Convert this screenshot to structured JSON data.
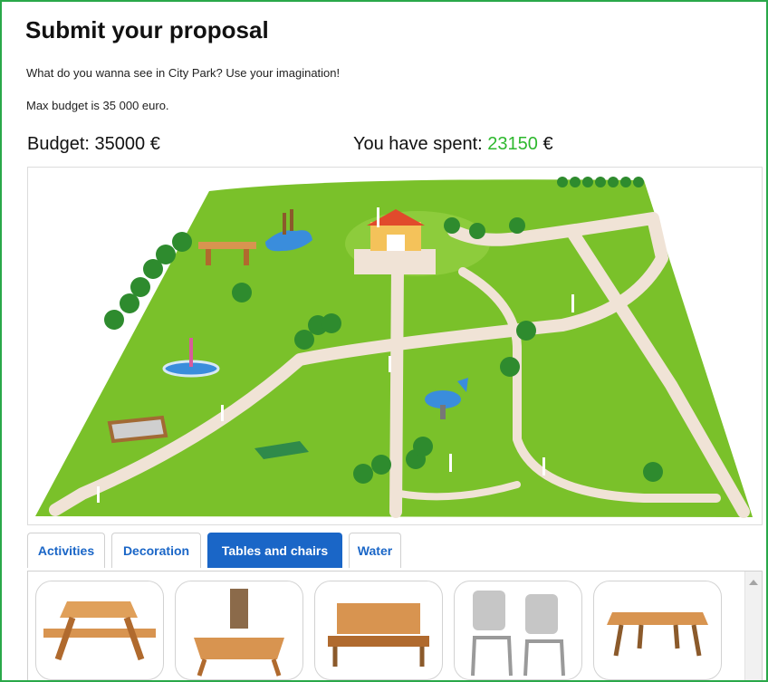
{
  "header": {
    "title": "Submit your proposal",
    "intro": "What do you wanna see in City Park? Use your imagination!",
    "max_budget": "Max budget is 35 000 euro."
  },
  "budget": {
    "label": "Budget:",
    "amount": "35000 €",
    "spent_label": "You have spent:",
    "spent_value": "23150",
    "currency": "€",
    "spent_color": "#2eb82e"
  },
  "tabs": [
    {
      "label": "Activities",
      "active": false
    },
    {
      "label": "Decoration",
      "active": false
    },
    {
      "label": "Tables and chairs",
      "active": true
    },
    {
      "label": "Water",
      "active": false
    }
  ],
  "items": [
    {
      "icon": "picnic-table-icon"
    },
    {
      "icon": "tree-bench-icon"
    },
    {
      "icon": "park-bench-icon"
    },
    {
      "icon": "metal-chairs-icon"
    },
    {
      "icon": "wooden-table-icon"
    }
  ],
  "colors": {
    "accent": "#1a66c7",
    "frame": "#2aa84a",
    "grass": "#7ac12a",
    "path": "#f0e3d6"
  }
}
